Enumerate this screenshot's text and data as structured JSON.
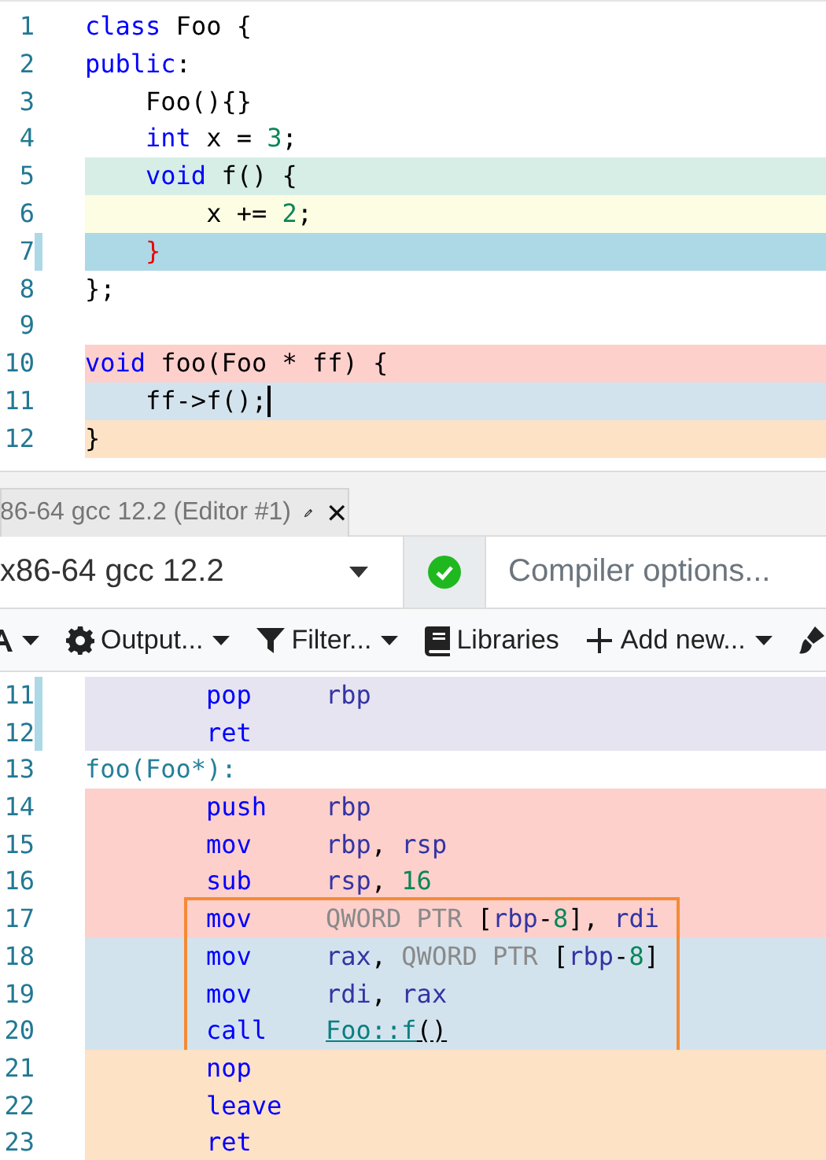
{
  "source": {
    "lines": [
      {
        "number": "1",
        "tokens": [
          {
            "text": "class",
            "kind": "keyword"
          },
          {
            "text": " Foo {",
            "kind": "plain"
          }
        ]
      },
      {
        "number": "2",
        "tokens": [
          {
            "text": "public",
            "kind": "keyword"
          },
          {
            "text": ":",
            "kind": "plain"
          }
        ]
      },
      {
        "number": "3",
        "tokens": [
          {
            "text": "    Foo(){}",
            "kind": "plain"
          }
        ]
      },
      {
        "number": "4",
        "tokens": [
          {
            "text": "    int",
            "kind": "keyword"
          },
          {
            "text": " x = ",
            "kind": "plain"
          },
          {
            "text": "3",
            "kind": "number"
          },
          {
            "text": ";",
            "kind": "plain"
          }
        ]
      },
      {
        "number": "5",
        "color": "#d6eee6",
        "tokens": [
          {
            "text": "    void",
            "kind": "keyword"
          },
          {
            "text": " f() {",
            "kind": "plain"
          }
        ]
      },
      {
        "number": "6",
        "color": "#fdfde3",
        "tokens": [
          {
            "text": "        x += ",
            "kind": "plain"
          },
          {
            "text": "2",
            "kind": "number"
          },
          {
            "text": ";",
            "kind": "plain"
          }
        ]
      },
      {
        "number": "7",
        "color": "#add8e6",
        "marked": true,
        "tokens": [
          {
            "text": "    }",
            "kind": "error"
          }
        ]
      },
      {
        "number": "8",
        "tokens": [
          {
            "text": "};",
            "kind": "plain"
          }
        ]
      },
      {
        "number": "9"
      },
      {
        "number": "10",
        "color": "#fdd0cc",
        "tokens": [
          {
            "text": "void",
            "kind": "keyword"
          },
          {
            "text": " foo(Foo * ff) {",
            "kind": "plain"
          }
        ]
      },
      {
        "number": "11",
        "color": "#d3e3ee",
        "cursor": true,
        "tokens": [
          {
            "text": "    ff->f();",
            "kind": "plain"
          }
        ]
      },
      {
        "number": "12",
        "color": "#fde2c6",
        "tokens": [
          {
            "text": "}",
            "kind": "plain"
          }
        ]
      }
    ]
  },
  "compiler_tab": {
    "title": "86-64 gcc 12.2 (Editor #1)",
    "close": "✕"
  },
  "compiler_bar": {
    "compiler": "x86-64 gcc 12.2",
    "options": {
      "placeholder": "Compiler options..."
    }
  },
  "toolbar": {
    "items": [
      {
        "kind": "font",
        "dropdown": true
      },
      {
        "kind": "gear",
        "label": "Output...",
        "dropdown": true
      },
      {
        "kind": "filter",
        "label": "Filter...",
        "dropdown": true
      },
      {
        "kind": "book",
        "label": "Libraries"
      },
      {
        "kind": "plus",
        "label": "Add new...",
        "dropdown": true
      },
      {
        "kind": "brush"
      }
    ]
  },
  "assembly": {
    "lines": [
      {
        "number": "11",
        "color": "#e6e4f0",
        "marked": true,
        "mnemonic": "pop",
        "operands": [
          {
            "text": "rbp",
            "kind": "register"
          }
        ]
      },
      {
        "number": "12",
        "color": "#e6e4f0",
        "marked": true,
        "mnemonic": "ret"
      },
      {
        "number": "13",
        "label": "foo(Foo*):"
      },
      {
        "number": "14",
        "color": "#fdd0cc",
        "mnemonic": "push",
        "operands": [
          {
            "text": "rbp",
            "kind": "register"
          }
        ]
      },
      {
        "number": "15",
        "color": "#fdd0cc",
        "mnemonic": "mov",
        "operands": [
          {
            "text": "rbp",
            "kind": "register"
          },
          {
            "text": ", ",
            "kind": "plain"
          },
          {
            "text": "rsp",
            "kind": "register"
          }
        ]
      },
      {
        "number": "16",
        "color": "#fdd0cc",
        "mnemonic": "sub",
        "operands": [
          {
            "text": "rsp",
            "kind": "register"
          },
          {
            "text": ", ",
            "kind": "plain"
          },
          {
            "text": "16",
            "kind": "number"
          }
        ]
      },
      {
        "number": "17",
        "color": "#fdd0cc",
        "boxed": true,
        "mnemonic": "mov",
        "operands": [
          {
            "text": "QWORD PTR ",
            "kind": "size"
          },
          {
            "text": "[",
            "kind": "plain"
          },
          {
            "text": "rbp",
            "kind": "register"
          },
          {
            "text": "-",
            "kind": "plain"
          },
          {
            "text": "8",
            "kind": "number"
          },
          {
            "text": "], ",
            "kind": "plain"
          },
          {
            "text": "rdi",
            "kind": "register"
          }
        ]
      },
      {
        "number": "18",
        "color": "#d3e3ee",
        "boxed": true,
        "mnemonic": "mov",
        "operands": [
          {
            "text": "rax",
            "kind": "register"
          },
          {
            "text": ", ",
            "kind": "plain"
          },
          {
            "text": "QWORD PTR ",
            "kind": "size"
          },
          {
            "text": "[",
            "kind": "plain"
          },
          {
            "text": "rbp",
            "kind": "register"
          },
          {
            "text": "-",
            "kind": "plain"
          },
          {
            "text": "8",
            "kind": "number"
          },
          {
            "text": "]",
            "kind": "plain"
          }
        ]
      },
      {
        "number": "19",
        "color": "#d3e3ee",
        "boxed": true,
        "mnemonic": "mov",
        "operands": [
          {
            "text": "rdi",
            "kind": "register"
          },
          {
            "text": ", ",
            "kind": "plain"
          },
          {
            "text": "rax",
            "kind": "register"
          }
        ]
      },
      {
        "number": "20",
        "color": "#d3e3ee",
        "boxed": true,
        "mnemonic": "call",
        "operands": [
          {
            "text": "Foo::f",
            "kind": "link"
          },
          {
            "text": "()",
            "kind": "link_args"
          }
        ]
      },
      {
        "number": "21",
        "color": "#fde2c6",
        "mnemonic": "nop"
      },
      {
        "number": "22",
        "color": "#fde2c6",
        "mnemonic": "leave"
      },
      {
        "number": "23",
        "color": "#fde2c6",
        "mnemonic": "ret"
      }
    ]
  }
}
